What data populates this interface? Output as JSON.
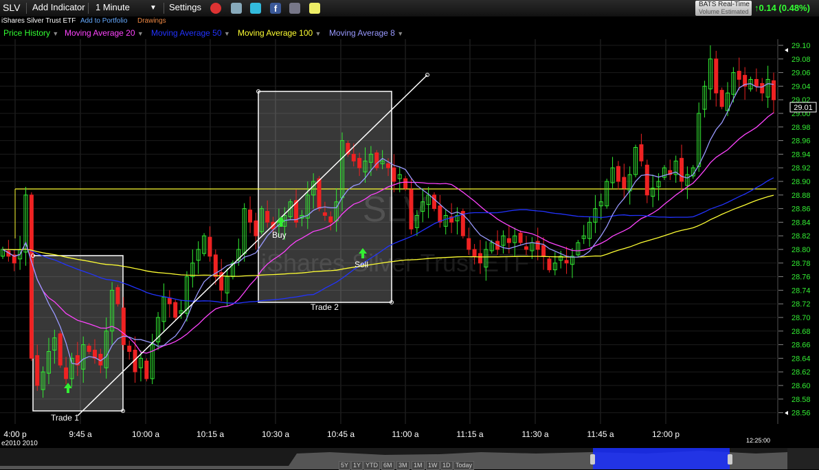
{
  "toolbar": {
    "symbol": "SLV",
    "add_indicator": "Add Indicator",
    "interval": "1 Minute",
    "settings": "Settings",
    "realtime_line1": "BATS Real-Time",
    "realtime_line2": "Volume Estimated",
    "change": "0.14 (0.48%)"
  },
  "subbar": {
    "name": "iShares Silver Trust ETF",
    "add_portfolio": "Add to Portfolio",
    "drawings": "Drawings"
  },
  "legend": {
    "items": [
      {
        "label": "Price History",
        "color": "#33ff33"
      },
      {
        "label": "Moving Average 20",
        "color": "#ff44ff"
      },
      {
        "label": "Moving Average 50",
        "color": "#2233ff"
      },
      {
        "label": "Moving Average 100",
        "color": "#ffff33"
      },
      {
        "label": "Moving Average 8",
        "color": "#9999ff"
      }
    ]
  },
  "watermark": {
    "symbol": "SLV",
    "name": "iShares Silver Trust ETF"
  },
  "annotations": {
    "trade1": "Trade 1",
    "trade2": "Trade 2",
    "buy": "Buy",
    "sell": "Sell"
  },
  "last_price_label": "29.01",
  "timestamp": "12:25:00",
  "date_label": "e2010  2010",
  "navigator": {
    "buttons": [
      "5Y",
      "1Y",
      "YTD",
      "6M",
      "3M",
      "1M",
      "1W",
      "1D",
      "Today"
    ]
  },
  "chart_data": {
    "type": "candlestick",
    "title": "",
    "y_ticks": [
      "29.10",
      "29.08",
      "29.06",
      "29.04",
      "29.02",
      "29.00",
      "28.98",
      "28.96",
      "28.94",
      "28.92",
      "28.90",
      "28.88",
      "28.86",
      "28.84",
      "28.82",
      "28.80",
      "28.78",
      "28.76",
      "28.74",
      "28.72",
      "28.70",
      "28.68",
      "28.66",
      "28.64",
      "28.62",
      "28.60",
      "28.58",
      "28.56"
    ],
    "ylim": [
      28.555,
      29.115
    ],
    "x_ticks": [
      "4:00 p",
      "9:45 a",
      "10:00 a",
      "10:15 a",
      "10:30 a",
      "10:45 a",
      "11:00 a",
      "11:15 a",
      "11:30 a",
      "11:45 a",
      "12:00 p"
    ],
    "grid": true,
    "close_series": [
      28.8,
      28.79,
      28.78,
      28.8,
      28.88,
      28.64,
      28.6,
      28.62,
      28.65,
      28.67,
      28.63,
      28.61,
      28.64,
      28.63,
      28.66,
      28.65,
      28.64,
      28.63,
      28.68,
      28.74,
      28.72,
      28.66,
      28.65,
      28.62,
      28.64,
      28.61,
      28.66,
      28.7,
      28.73,
      28.72,
      28.7,
      28.71,
      28.76,
      28.78,
      28.8,
      28.82,
      28.79,
      28.76,
      28.74,
      28.76,
      28.78,
      28.8,
      28.86,
      28.84,
      28.82,
      28.86,
      28.84,
      28.83,
      28.84,
      28.85,
      28.87,
      28.84,
      28.85,
      28.88,
      28.9,
      28.86,
      28.85,
      28.84,
      28.87,
      28.96,
      28.94,
      28.93,
      28.92,
      28.93,
      28.94,
      28.92,
      28.93,
      28.92,
      28.9,
      28.91,
      28.89,
      28.83,
      28.85,
      28.87,
      28.88,
      28.86,
      28.84,
      28.85,
      28.84,
      28.85,
      28.82,
      28.8,
      28.79,
      28.78,
      28.8,
      28.81,
      28.8,
      28.82,
      28.81,
      28.82,
      28.81,
      28.8,
      28.81,
      28.8,
      28.79,
      28.77,
      28.78,
      28.79,
      28.78,
      28.79,
      28.81,
      28.82,
      28.84,
      28.86,
      28.87,
      28.9,
      28.92,
      28.9,
      28.89,
      28.91,
      28.95,
      28.93,
      28.88,
      28.89,
      28.9,
      28.92,
      28.91,
      28.93,
      28.9,
      28.91,
      28.92,
      29.0,
      29.04,
      29.08,
      29.03,
      29.01,
      29.03,
      29.06,
      29.05,
      29.04,
      29.05,
      29.04,
      29.03,
      29.05,
      29.02
    ],
    "moving_averages": [
      {
        "name": "Moving Average 20",
        "color": "#ff44ff"
      },
      {
        "name": "Moving Average 50",
        "color": "#2233ff"
      },
      {
        "name": "Moving Average 100",
        "color": "#ffff33"
      },
      {
        "name": "Moving Average 8",
        "color": "#9999ff"
      }
    ],
    "horizontal_line": 28.89,
    "legend_position": "top-left"
  }
}
